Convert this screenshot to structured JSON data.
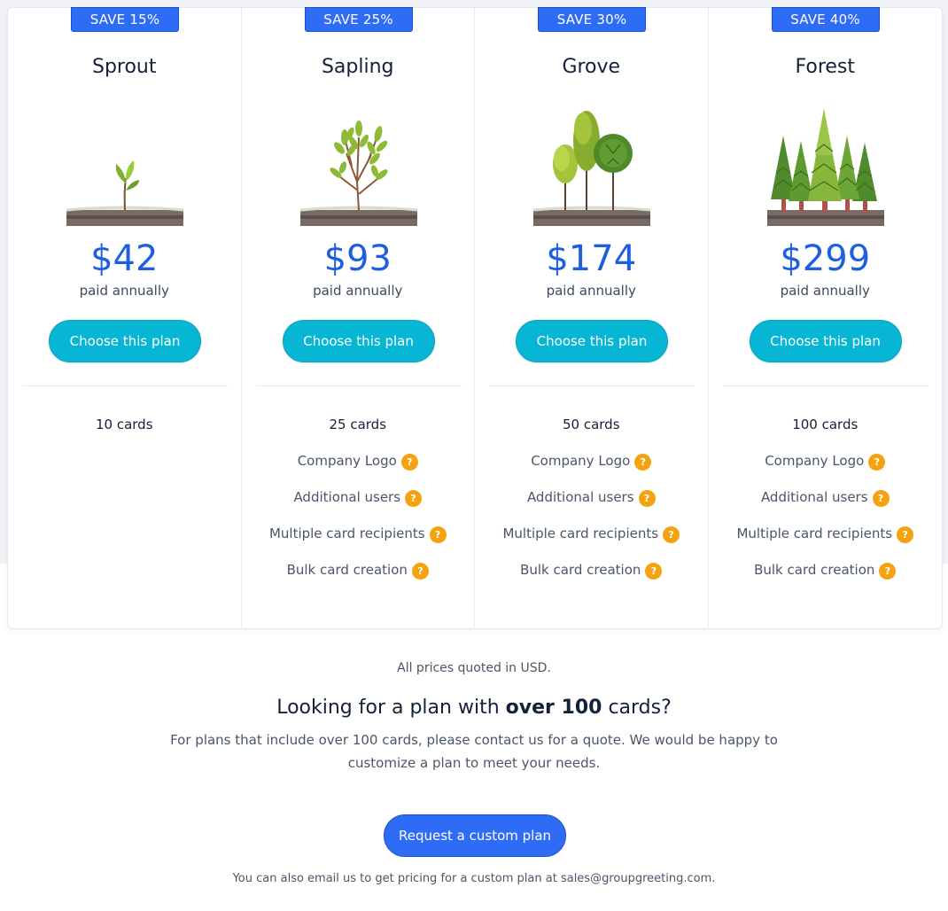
{
  "plans": [
    {
      "badge": "SAVE 15%",
      "name": "Sprout",
      "illustration": "sprout-icon",
      "price": "$42",
      "billing": "paid annually",
      "button": "Choose this plan",
      "features": [
        "10 cards"
      ]
    },
    {
      "badge": "SAVE 25%",
      "name": "Sapling",
      "illustration": "sapling-icon",
      "price": "$93",
      "billing": "paid annually",
      "button": "Choose this plan",
      "features": [
        "25 cards",
        "Company Logo",
        "Additional users",
        "Multiple card recipients",
        "Bulk card creation"
      ]
    },
    {
      "badge": "SAVE 30%",
      "name": "Grove",
      "illustration": "grove-icon",
      "price": "$174",
      "billing": "paid annually",
      "button": "Choose this plan",
      "features": [
        "50 cards",
        "Company Logo",
        "Additional users",
        "Multiple card recipients",
        "Bulk card creation"
      ]
    },
    {
      "badge": "SAVE 40%",
      "name": "Forest",
      "illustration": "forest-icon",
      "price": "$299",
      "billing": "paid annually",
      "button": "Choose this plan",
      "features": [
        "100 cards",
        "Company Logo",
        "Additional users",
        "Multiple card recipients",
        "Bulk card creation"
      ]
    }
  ],
  "help_icon_glyph": "?",
  "footer": {
    "currency_note": "All prices quoted in USD.",
    "heading_pre": "Looking for a plan with ",
    "heading_bold": "over 100",
    "heading_post": " cards?",
    "description": "For plans that include over 100 cards, please contact us for a quote. We would be happy to customize a plan to meet your needs.",
    "custom_button": "Request a custom plan",
    "email_pre": "You can also email us to get pricing for a custom plan at ",
    "email": "sales@groupgreeting.com",
    "email_post": "."
  },
  "colors": {
    "badge": "#2f6cf6",
    "price": "#1e5fe0",
    "choose_button": "#06b6d4",
    "custom_button": "#2f6cf6",
    "help_icon": "#f4a20f"
  }
}
